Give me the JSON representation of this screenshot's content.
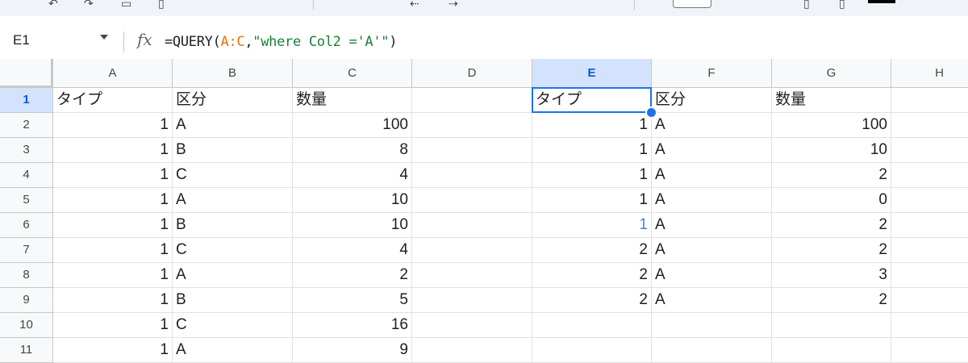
{
  "formula_bar": {
    "name_box": "E1",
    "fx_label": "fx",
    "formula_prefix": "=QUERY(",
    "formula_range": "A:C",
    "formula_comma": ",",
    "formula_string": "\"where Col2 ='A'\"",
    "formula_suffix": ")"
  },
  "selection": {
    "active_cell": "E1",
    "selected_column": "E",
    "selected_row": "1"
  },
  "columns": [
    "A",
    "B",
    "C",
    "D",
    "E",
    "F",
    "G",
    "H"
  ],
  "rows": [
    "1",
    "2",
    "3",
    "4",
    "5",
    "6",
    "7",
    "8",
    "9",
    "10",
    "11"
  ],
  "cells": {
    "A": [
      "タイプ",
      "1",
      "1",
      "1",
      "1",
      "1",
      "1",
      "1",
      "1",
      "1",
      "1"
    ],
    "B": [
      "区分",
      "A",
      "B",
      "C",
      "A",
      "B",
      "C",
      "A",
      "B",
      "C",
      "A"
    ],
    "C": [
      "数量",
      "100",
      "8",
      "4",
      "10",
      "10",
      "4",
      "2",
      "5",
      "16",
      "9"
    ],
    "D": [
      "",
      "",
      "",
      "",
      "",
      "",
      "",
      "",
      "",
      "",
      ""
    ],
    "E": [
      "タイプ",
      "1",
      "1",
      "1",
      "1",
      "1",
      "2",
      "2",
      "2",
      "",
      ""
    ],
    "F": [
      "区分",
      "A",
      "A",
      "A",
      "A",
      "A",
      "A",
      "A",
      "A",
      "",
      ""
    ],
    "G": [
      "数量",
      "100",
      "10",
      "2",
      "0",
      "2",
      "2",
      "3",
      "2",
      "",
      ""
    ],
    "H": [
      "",
      "",
      "",
      "",
      "",
      "",
      "",
      "",
      "",
      "",
      ""
    ]
  },
  "colors": {
    "selection_blue": "#1a73e8",
    "header_selected": "#d3e3fd",
    "formula_range": "#e8710a",
    "formula_string": "#188038"
  }
}
